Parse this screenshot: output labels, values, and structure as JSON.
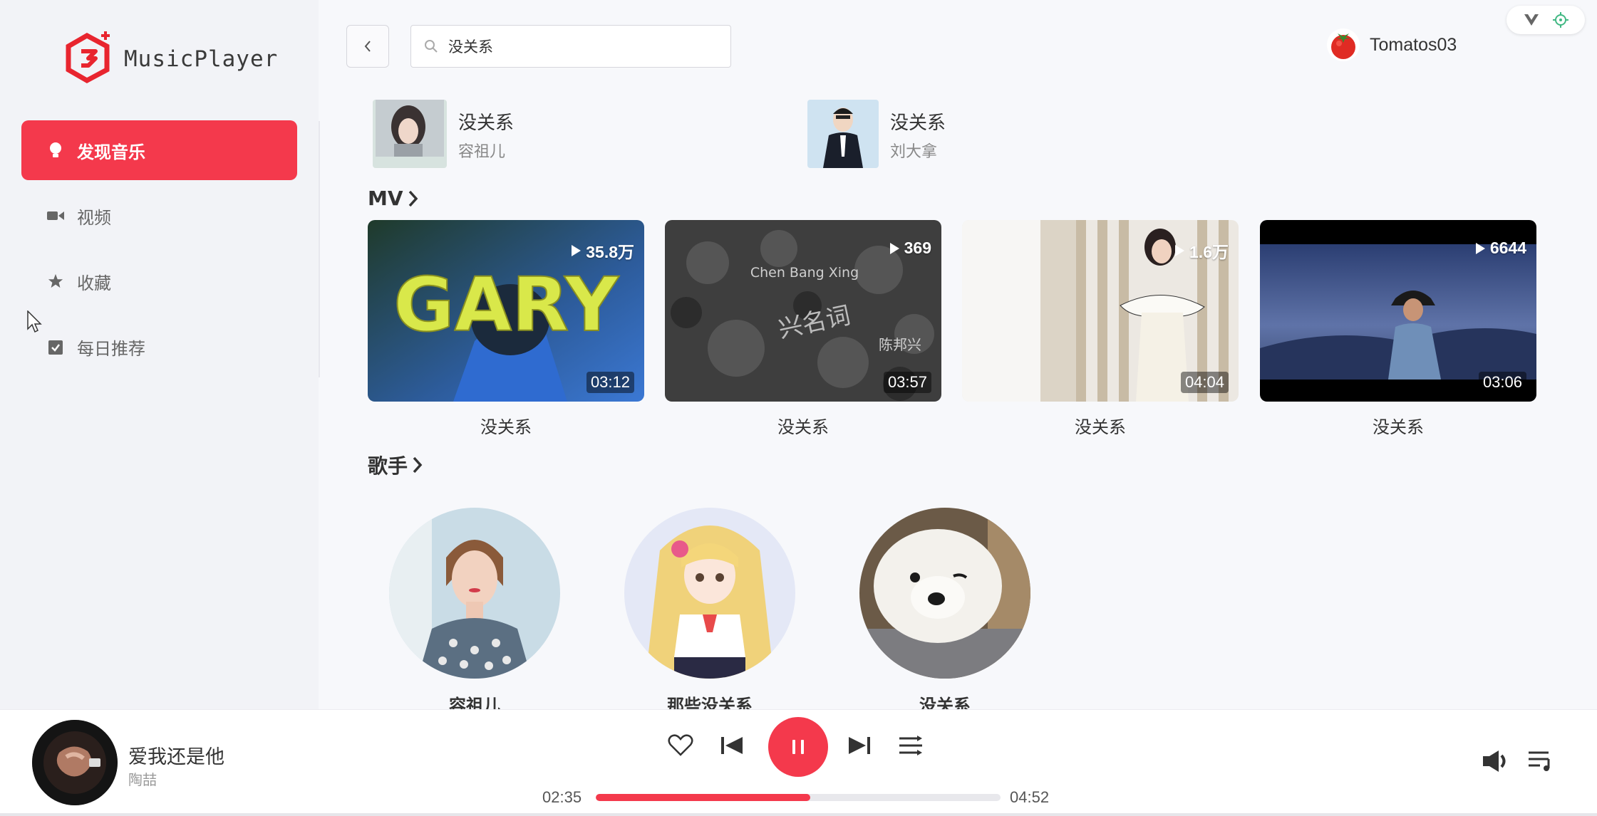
{
  "app": {
    "name": "MusicPlayer"
  },
  "sidebar": {
    "items": [
      {
        "label": "发现音乐",
        "icon": "lightbulb-icon",
        "active": true
      },
      {
        "label": "视频",
        "icon": "video-camera-icon",
        "active": false
      },
      {
        "label": "收藏",
        "icon": "star-icon",
        "active": false
      },
      {
        "label": "每日推荐",
        "icon": "calendar-check-icon",
        "active": false
      }
    ]
  },
  "search": {
    "value": "没关系",
    "placeholder": ""
  },
  "user": {
    "name": "Tomatos03",
    "avatar": "tomato-avatar"
  },
  "songs": [
    {
      "title": "没关系",
      "artist": "容祖儿"
    },
    {
      "title": "没关系",
      "artist": "刘大拿"
    }
  ],
  "sections": {
    "mv": "MV",
    "singers": "歌手"
  },
  "mvs": [
    {
      "plays": "35.8万",
      "duration": "03:12",
      "title": "没关系",
      "cover_text": "GARY"
    },
    {
      "plays": "369",
      "duration": "03:57",
      "title": "没关系",
      "cover_text": "兴名词",
      "cover_sub": "Chen Bang Xing",
      "cover_sub2": "陈邦兴"
    },
    {
      "plays": "1.6万",
      "duration": "04:04",
      "title": "没关系"
    },
    {
      "plays": "6644",
      "duration": "03:06",
      "title": "没关系"
    }
  ],
  "singers": [
    {
      "name": "容祖儿"
    },
    {
      "name": "那些没关系"
    },
    {
      "name": "没关系"
    }
  ],
  "player": {
    "title": "爱我还是他",
    "artist": "陶喆",
    "current_time": "02:35",
    "total_time": "04:52",
    "progress": 0.53
  },
  "colors": {
    "accent": "#f4394c"
  }
}
